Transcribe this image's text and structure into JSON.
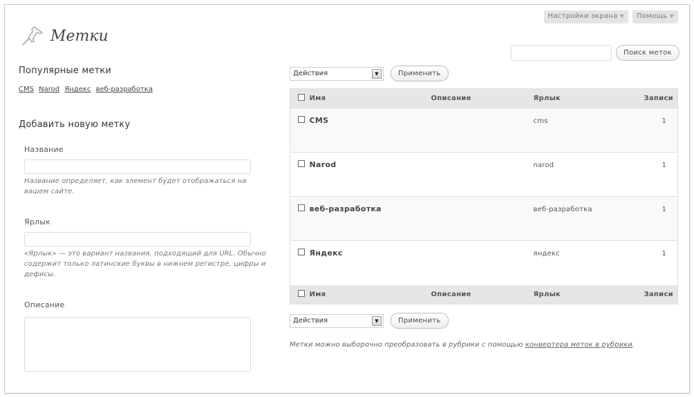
{
  "screen_meta": {
    "screen_options": "Настройки экрана",
    "help": "Помощь"
  },
  "page": {
    "title": "Метки",
    "icon": "pushpin-icon"
  },
  "search": {
    "value": "",
    "button": "Поиск меток"
  },
  "popular": {
    "heading": "Популярные метки",
    "tags": [
      "CMS",
      "Narod",
      "Яндекс",
      "веб-разработка"
    ]
  },
  "add_tag": {
    "heading": "Добавить новую метку",
    "name_label": "Название",
    "name_value": "",
    "name_hint": "Название определяет, как элемент будет отображаться на вашем сайте.",
    "slug_label": "Ярлык",
    "slug_value": "",
    "slug_hint": "«Ярлык» — это вариант названия, подходящий для URL. Обычно содержит только латинские буквы в нижнем регистре, цифры и дефисы.",
    "desc_label": "Описание",
    "desc_value": ""
  },
  "bulk_top": {
    "select_value": "Действия",
    "apply": "Применить"
  },
  "table": {
    "columns": {
      "name": "Имя",
      "description": "Описание",
      "slug": "Ярлык",
      "count": "Записи"
    },
    "rows": [
      {
        "name": "CMS",
        "description": "",
        "slug": "cms",
        "count": "1"
      },
      {
        "name": "Narod",
        "description": "",
        "slug": "narod",
        "count": "1"
      },
      {
        "name": "веб-разработка",
        "description": "",
        "slug": "веб-разработка",
        "count": "1"
      },
      {
        "name": "Яндекс",
        "description": "",
        "slug": "яндекс",
        "count": "1"
      }
    ]
  },
  "bulk_bottom": {
    "select_value": "Действия",
    "apply": "Применить"
  },
  "note": {
    "text": "Метки можно выборочно преобразовать в рубрики с помощью ",
    "link": "конвертера меток в рубрики",
    "end": "."
  }
}
